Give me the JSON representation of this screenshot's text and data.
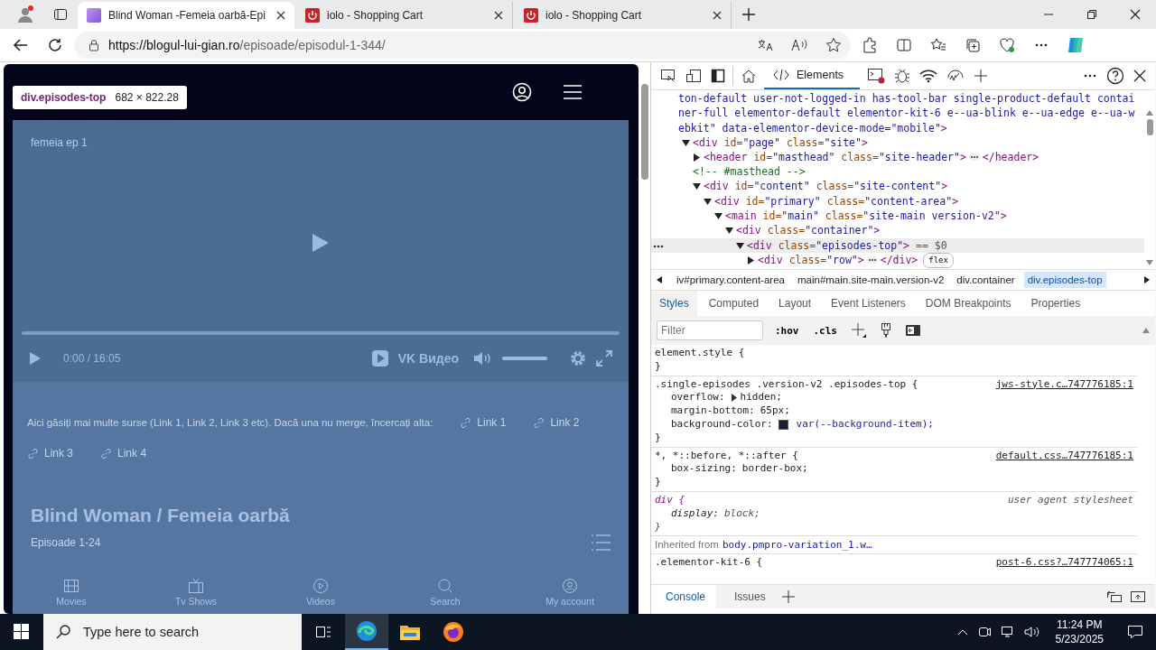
{
  "browser": {
    "tabs": [
      {
        "title": "Blind Woman -Femeia oarbă-Epi",
        "selected": true
      },
      {
        "title": "iolo - Shopping Cart",
        "selected": false
      },
      {
        "title": "iolo - Shopping Cart",
        "selected": false
      }
    ],
    "address": {
      "host": "https://blogul-lui-gian.ro",
      "path": "/episoade/episodul-1-344/"
    }
  },
  "page": {
    "tooltip": {
      "selector": "div.episodes-top",
      "size": "682 × 822.28"
    },
    "player": {
      "title": "femeia ep 1",
      "time": "0:00 / 16:05",
      "brand": "VK Видео",
      "progress": {
        "level": 0
      },
      "volume": {
        "level": 1
      }
    },
    "sources_text": "Aici găsiți mai multe surse (Link 1, Link 2, Link 3 etc). Dacă una nu merge, încercați alta:",
    "links": [
      "Link 1",
      "Link 2",
      "Link 3",
      "Link 4"
    ],
    "show_title": "Blind Woman / Femeia oarbă",
    "episodes": "Episoade 1-24",
    "bottom_nav": [
      "Movies",
      "Tv Shows",
      "Videos",
      "Search",
      "My account"
    ]
  },
  "devtools": {
    "tabs": [
      {
        "label": "Elements",
        "selected": true
      }
    ],
    "dom": {
      "attr_tail": "ton-default user-not-logged-in has-tool-bar single-product-default container-full elementor-default elementor-kit-6 e--ua-blink e--ua-edge e--ua-webkit\" data-elementor-device-mode=\"mobile\">",
      "tree": [
        {
          "open": "<div id=\"page\" class=\"site\">",
          "expanded": true,
          "selected": false,
          "children": [
            {
              "open": "<header id=\"masthead\" class=\"site-header\">",
              "close": "</header>",
              "expanded": false,
              "selected": false
            },
            {
              "kind": "comment",
              "open": "<!-- #masthead -->"
            },
            {
              "open": "<div id=\"content\" class=\"site-content\">",
              "expanded": true,
              "selected": false,
              "children": [
                {
                  "open": "<div id=\"primary\" class=\"content-area\">",
                  "expanded": true,
                  "selected": false,
                  "children": [
                    {
                      "open": "<main id=\"main\" class=\"site-main version-v2\">",
                      "expanded": true,
                      "selected": false,
                      "children": [
                        {
                          "open": "<div class=\"container\">",
                          "expanded": true,
                          "selected": false,
                          "children": [
                            {
                              "open": "<div class=\"episodes-top\">",
                              "suffix": "== $0",
                              "expanded": true,
                              "selected": true,
                              "children": [
                                {
                                  "open": "<div class=\"row\">",
                                  "close": "</div>",
                                  "badge": "flex",
                                  "expanded": false,
                                  "selected": false
                                }
                              ]
                            }
                          ]
                        }
                      ]
                    }
                  ]
                }
              ]
            }
          ]
        }
      ]
    },
    "breadcrumbs": [
      {
        "label": "iv#primary.content-area",
        "selected": false
      },
      {
        "label": "main#main.site-main.version-v2",
        "selected": false
      },
      {
        "label": "div.container",
        "selected": false
      },
      {
        "label": "div.episodes-top",
        "selected": true
      }
    ],
    "pane_tabs": [
      {
        "label": "Styles",
        "selected": true
      },
      {
        "label": "Computed",
        "selected": false
      },
      {
        "label": "Layout",
        "selected": false
      },
      {
        "label": "Event Listeners",
        "selected": false
      },
      {
        "label": "DOM Breakpoints",
        "selected": false
      },
      {
        "label": "Properties",
        "selected": false
      }
    ],
    "filter": {
      "placeholder": "Filter"
    },
    "toolbar": [
      ":hov",
      ".cls"
    ],
    "rules": [
      {
        "kind": "author",
        "selector": "element.style {",
        "close": "}"
      },
      {
        "kind": "author",
        "selector": ".single-episodes .version-v2 .episodes-top {",
        "source": "jws-style.c…747776185:1",
        "close": "}",
        "properties": [
          {
            "name": "overflow:",
            "value": "hidden;",
            "expandable": true
          },
          {
            "name": "margin-bottom:",
            "value": "65px;"
          },
          {
            "name": "background-color:",
            "value": "var(--background-item);",
            "color": "#1a1f33"
          }
        ]
      },
      {
        "kind": "author",
        "selector": "*, *::before, *::after {",
        "source": "default.css…747776185:1",
        "close": "}",
        "properties": [
          {
            "name": "box-sizing:",
            "value": "border-box;"
          }
        ]
      },
      {
        "kind": "user_agent",
        "selector": "div {",
        "source": "user agent stylesheet",
        "close": "}",
        "properties": [
          {
            "name": "display:",
            "value": "block;"
          }
        ]
      }
    ],
    "inherited": {
      "label": "Inherited from",
      "element": "body.pmpro-variation_1.w…"
    },
    "last_rule": {
      "selector": ".elementor-kit-6 {",
      "source": "post-6.css?…747774065:1"
    },
    "drawer_tabs": [
      {
        "label": "Console",
        "selected": true
      },
      {
        "label": "Issues",
        "selected": false
      }
    ]
  },
  "taskbar": {
    "search_placeholder": "Type here to search",
    "time": "11:24 PM",
    "date": "5/23/2025"
  }
}
